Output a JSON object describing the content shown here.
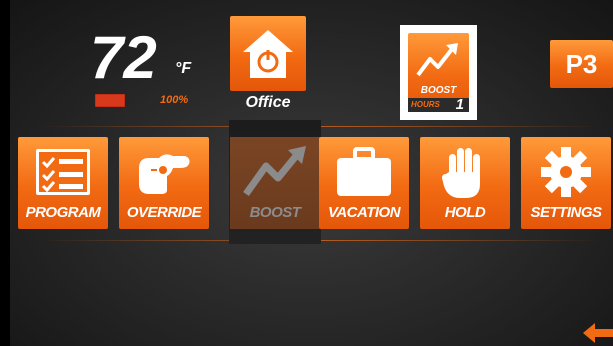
{
  "status": {
    "temperature": "72",
    "unit": "°F",
    "battery_percent": "100%"
  },
  "zone": {
    "label": "Office"
  },
  "boost_status": {
    "label": "BOOST",
    "hours_label": "HOURS",
    "hours_value": "1"
  },
  "program_badge": "P3",
  "menu": [
    {
      "label": "PROGRAM",
      "icon": "checklist-icon"
    },
    {
      "label": "OVERRIDE",
      "icon": "pointing-hand-icon"
    },
    {
      "label": "BOOST",
      "icon": "trend-up-arrow-icon",
      "state": "selected-disabled"
    },
    {
      "label": "VACATION",
      "icon": "suitcase-icon"
    },
    {
      "label": "HOLD",
      "icon": "stop-hand-icon"
    },
    {
      "label": "SETTINGS",
      "icon": "gear-icon"
    }
  ],
  "colors": {
    "accent": "#f26a12",
    "battery": "#d8391c",
    "background": "#262626"
  }
}
